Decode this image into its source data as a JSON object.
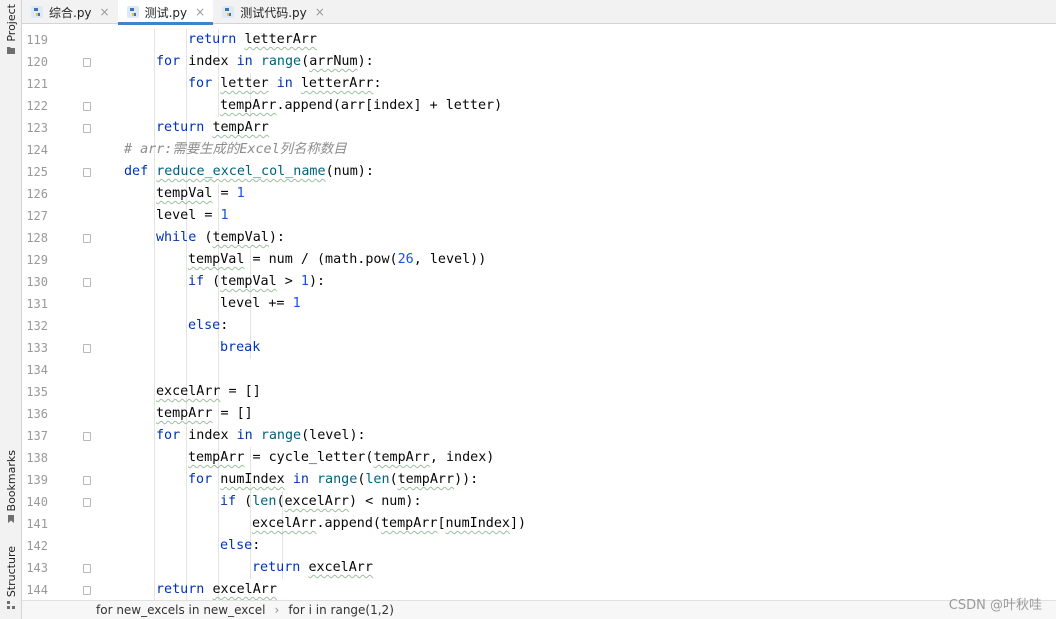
{
  "tool_window_labels": {
    "project": "Project",
    "bookmarks": "Bookmarks",
    "structure": "Structure"
  },
  "tabs": [
    {
      "label": "综合.py",
      "active": false
    },
    {
      "label": "测试.py",
      "active": true
    },
    {
      "label": "测试代码.py",
      "active": false
    }
  ],
  "close_glyph": "×",
  "lines": [
    {
      "n": "119",
      "indent": 4,
      "fold": false,
      "tokens": [
        [
          "kw",
          "return"
        ],
        [
          "t",
          " "
        ],
        [
          "tw",
          "letterArr"
        ]
      ]
    },
    {
      "n": "120",
      "indent": 3,
      "fold": true,
      "tokens": [
        [
          "kw",
          "for"
        ],
        [
          "t",
          " index "
        ],
        [
          "kw",
          "in"
        ],
        [
          "t",
          " "
        ],
        [
          "fn",
          "range"
        ],
        [
          "t",
          "("
        ],
        [
          "tw",
          "arrNum"
        ],
        [
          "t",
          "):"
        ]
      ]
    },
    {
      "n": "121",
      "indent": 4,
      "fold": false,
      "tokens": [
        [
          "kw",
          "for"
        ],
        [
          "t",
          " "
        ],
        [
          "tw",
          "letter"
        ],
        [
          "t",
          " "
        ],
        [
          "kw",
          "in"
        ],
        [
          "t",
          " "
        ],
        [
          "tw",
          "letterArr"
        ],
        [
          "t",
          ":"
        ]
      ]
    },
    {
      "n": "122",
      "indent": 5,
      "fold": true,
      "tokens": [
        [
          "tw",
          "tempArr"
        ],
        [
          "t",
          ".append(arr[index] + letter)"
        ]
      ]
    },
    {
      "n": "123",
      "indent": 3,
      "fold": true,
      "tokens": [
        [
          "kw",
          "return"
        ],
        [
          "t",
          " "
        ],
        [
          "tw",
          "tempArr"
        ]
      ]
    },
    {
      "n": "124",
      "indent": 2,
      "fold": false,
      "tokens": [
        [
          "cmt",
          "# arr:需要生成的Excel列名称数目"
        ]
      ]
    },
    {
      "n": "125",
      "indent": 2,
      "fold": true,
      "tokens": [
        [
          "kw",
          "def"
        ],
        [
          "t",
          " "
        ],
        [
          "fnw",
          "reduce_excel_col_name"
        ],
        [
          "t",
          "(num):"
        ]
      ]
    },
    {
      "n": "126",
      "indent": 3,
      "fold": false,
      "tokens": [
        [
          "tw",
          "tempVal"
        ],
        [
          "t",
          " = "
        ],
        [
          "num",
          "1"
        ]
      ]
    },
    {
      "n": "127",
      "indent": 3,
      "fold": false,
      "tokens": [
        [
          "t",
          "level = "
        ],
        [
          "num",
          "1"
        ]
      ]
    },
    {
      "n": "128",
      "indent": 3,
      "fold": true,
      "tokens": [
        [
          "kw",
          "while"
        ],
        [
          "t",
          " ("
        ],
        [
          "tw",
          "tempVal"
        ],
        [
          "t",
          "):"
        ]
      ]
    },
    {
      "n": "129",
      "indent": 4,
      "fold": false,
      "tokens": [
        [
          "tw",
          "tempVal"
        ],
        [
          "t",
          " = num / (math.pow("
        ],
        [
          "num",
          "26"
        ],
        [
          "t",
          ", level))"
        ]
      ]
    },
    {
      "n": "130",
      "indent": 4,
      "fold": true,
      "tokens": [
        [
          "kw",
          "if"
        ],
        [
          "t",
          " ("
        ],
        [
          "tw",
          "tempVal"
        ],
        [
          "t",
          " > "
        ],
        [
          "num",
          "1"
        ],
        [
          "t",
          "):"
        ]
      ]
    },
    {
      "n": "131",
      "indent": 5,
      "fold": false,
      "tokens": [
        [
          "t",
          "level += "
        ],
        [
          "num",
          "1"
        ]
      ]
    },
    {
      "n": "132",
      "indent": 4,
      "fold": false,
      "tokens": [
        [
          "kw",
          "else"
        ],
        [
          "t",
          ":"
        ]
      ]
    },
    {
      "n": "133",
      "indent": 5,
      "fold": true,
      "tokens": [
        [
          "kw",
          "break"
        ]
      ]
    },
    {
      "n": "134",
      "indent": 0,
      "fold": false,
      "tokens": []
    },
    {
      "n": "135",
      "indent": 3,
      "fold": false,
      "tokens": [
        [
          "tw",
          "excelArr"
        ],
        [
          "t",
          " = []"
        ]
      ]
    },
    {
      "n": "136",
      "indent": 3,
      "fold": false,
      "tokens": [
        [
          "tw",
          "tempArr"
        ],
        [
          "t",
          " = []"
        ]
      ]
    },
    {
      "n": "137",
      "indent": 3,
      "fold": true,
      "tokens": [
        [
          "kw",
          "for"
        ],
        [
          "t",
          " index "
        ],
        [
          "kw",
          "in"
        ],
        [
          "t",
          " "
        ],
        [
          "fn",
          "range"
        ],
        [
          "t",
          "(level):"
        ]
      ]
    },
    {
      "n": "138",
      "indent": 4,
      "fold": false,
      "tokens": [
        [
          "tw",
          "tempArr"
        ],
        [
          "t",
          " = cycle_letter("
        ],
        [
          "tw",
          "tempArr"
        ],
        [
          "t",
          ", index)"
        ]
      ]
    },
    {
      "n": "139",
      "indent": 4,
      "fold": true,
      "tokens": [
        [
          "kw",
          "for"
        ],
        [
          "t",
          " "
        ],
        [
          "tw",
          "numIndex"
        ],
        [
          "t",
          " "
        ],
        [
          "kw",
          "in"
        ],
        [
          "t",
          " "
        ],
        [
          "fn",
          "range"
        ],
        [
          "t",
          "("
        ],
        [
          "fn",
          "len"
        ],
        [
          "t",
          "("
        ],
        [
          "tw",
          "tempArr"
        ],
        [
          "t",
          ")):"
        ]
      ]
    },
    {
      "n": "140",
      "indent": 5,
      "fold": true,
      "tokens": [
        [
          "kw",
          "if"
        ],
        [
          "t",
          " ("
        ],
        [
          "fn",
          "len"
        ],
        [
          "t",
          "("
        ],
        [
          "tw",
          "excelArr"
        ],
        [
          "t",
          ") < num):"
        ]
      ]
    },
    {
      "n": "141",
      "indent": 6,
      "fold": false,
      "tokens": [
        [
          "tw",
          "excelArr"
        ],
        [
          "t",
          ".append("
        ],
        [
          "tw",
          "tempArr"
        ],
        [
          "t",
          "["
        ],
        [
          "tw",
          "numIndex"
        ],
        [
          "t",
          "])"
        ]
      ]
    },
    {
      "n": "142",
      "indent": 5,
      "fold": false,
      "tokens": [
        [
          "kw",
          "else"
        ],
        [
          "t",
          ":"
        ]
      ]
    },
    {
      "n": "143",
      "indent": 6,
      "fold": true,
      "tokens": [
        [
          "kw",
          "return"
        ],
        [
          "t",
          " "
        ],
        [
          "tw",
          "excelArr"
        ]
      ]
    },
    {
      "n": "144",
      "indent": 3,
      "fold": true,
      "tokens": [
        [
          "kw",
          "return"
        ],
        [
          "t",
          " "
        ],
        [
          "tw",
          "excelArr"
        ]
      ]
    }
  ],
  "breadcrumbs": [
    "for new_excels in new_excel",
    "for i in range(1,2)"
  ],
  "breadcrumb_separator": "›",
  "watermark": "CSDN @叶秋哇",
  "colors": {
    "keyword": "#0033b3",
    "number": "#1750eb",
    "comment": "#8c8c8c",
    "builtin": "#00627a",
    "tab_underline": "#4083c9"
  }
}
